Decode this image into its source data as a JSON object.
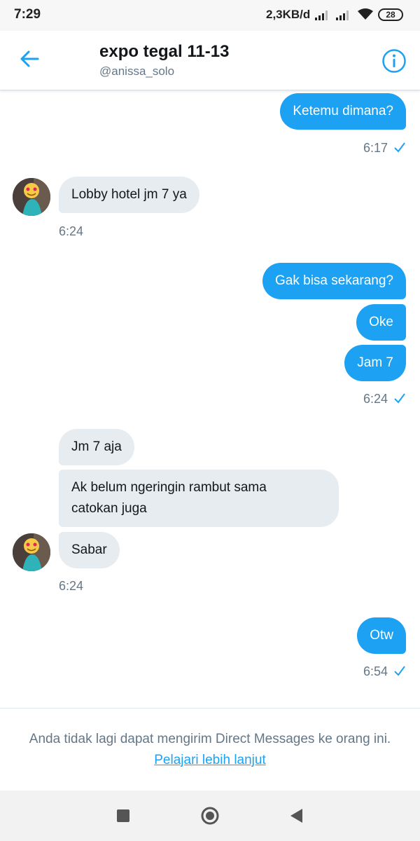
{
  "status_bar": {
    "time": "7:29",
    "speed": "2,3KB/d",
    "battery": "28"
  },
  "header": {
    "title": "expo tegal 11-13",
    "handle": "@anissa_solo"
  },
  "messages": {
    "m1": "Ketemu dimana?",
    "t1": "6:17",
    "m2": "Lobby hotel jm 7 ya",
    "t2": "6:24",
    "m3": "Gak bisa sekarang?",
    "m4": "Oke",
    "m5": "Jam 7",
    "t3": "6:24",
    "m6": "Jm 7 aja",
    "m7_line1": "Ak belum ngeringin rambut sama",
    "m7_line2": "catokan juga",
    "m8": "Sabar",
    "t4": "6:24",
    "m9": "Otw",
    "t5": "6:54"
  },
  "notice": {
    "text": "Anda tidak lagi dapat mengirim Direct Messages ke orang ini.",
    "link": "Pelajari lebih lanjut"
  },
  "colors": {
    "accent": "#1da1f2",
    "incoming": "#e6ecf0"
  }
}
